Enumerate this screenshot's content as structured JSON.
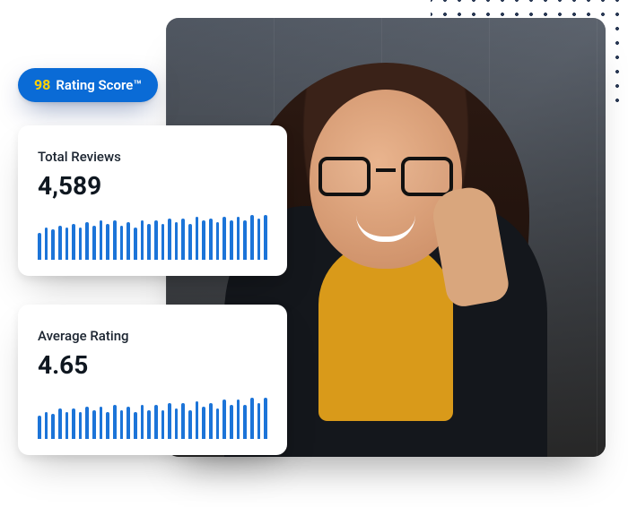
{
  "rating_pill": {
    "score": "98",
    "label": "Rating Score™"
  },
  "cards": {
    "total_reviews": {
      "label": "Total Reviews",
      "value": "4,589"
    },
    "average_rating": {
      "label": "Average Rating",
      "value": "4.65"
    }
  },
  "photo": {
    "alt": "Smiling woman wearing glasses and a black leather jacket over a mustard turtleneck, talking on a phone"
  },
  "colors": {
    "accent_blue": "#0a6bd6",
    "bar_blue": "#1c74d8",
    "score_yellow": "#ffd200"
  },
  "chart_data": [
    {
      "type": "bar",
      "title": "Total Reviews",
      "xlabel": "",
      "ylabel": "",
      "ylim": [
        0,
        52
      ],
      "categories": [
        "1",
        "2",
        "3",
        "4",
        "5",
        "6",
        "7",
        "8",
        "9",
        "10",
        "11",
        "12",
        "13",
        "14",
        "15",
        "16",
        "17",
        "18",
        "19",
        "20",
        "21",
        "22",
        "23",
        "24",
        "25",
        "26",
        "27",
        "28",
        "29",
        "30",
        "31",
        "32",
        "33",
        "34"
      ],
      "values": [
        30,
        36,
        34,
        38,
        36,
        40,
        36,
        42,
        38,
        44,
        40,
        44,
        38,
        42,
        36,
        44,
        40,
        44,
        40,
        46,
        42,
        46,
        40,
        48,
        44,
        46,
        42,
        48,
        44,
        48,
        44,
        50,
        46,
        50
      ]
    },
    {
      "type": "bar",
      "title": "Average Rating",
      "xlabel": "",
      "ylabel": "",
      "ylim": [
        0,
        52
      ],
      "categories": [
        "1",
        "2",
        "3",
        "4",
        "5",
        "6",
        "7",
        "8",
        "9",
        "10",
        "11",
        "12",
        "13",
        "14",
        "15",
        "16",
        "17",
        "18",
        "19",
        "20",
        "21",
        "22",
        "23",
        "24",
        "25",
        "26",
        "27",
        "28",
        "29",
        "30",
        "31",
        "32",
        "33",
        "34"
      ],
      "values": [
        26,
        30,
        28,
        34,
        30,
        34,
        30,
        36,
        32,
        36,
        30,
        38,
        32,
        36,
        30,
        38,
        32,
        38,
        32,
        40,
        34,
        40,
        32,
        42,
        36,
        40,
        34,
        44,
        38,
        44,
        38,
        46,
        40,
        46
      ]
    }
  ]
}
